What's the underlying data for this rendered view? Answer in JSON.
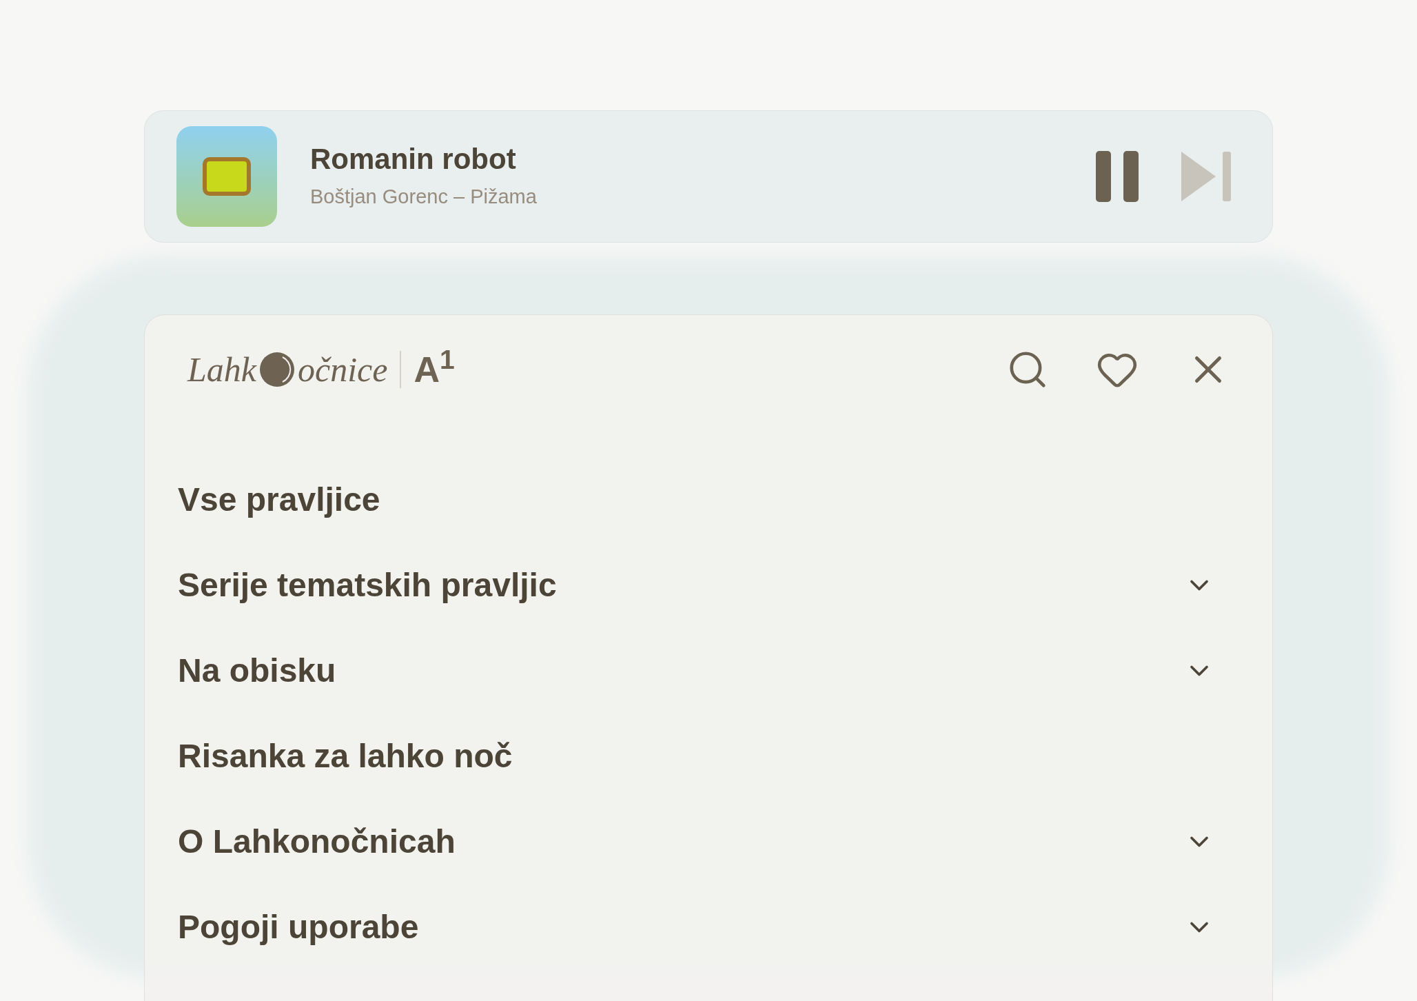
{
  "player": {
    "title": "Romanin robot",
    "subtitle": "Boštjan Gorenc – Pižama",
    "playing": true,
    "next_disabled": true
  },
  "header": {
    "logo_start": "Lahk",
    "logo_end": "očnice",
    "partner": "A$^{1}$"
  },
  "menu": [
    {
      "label": "Vse pravljice",
      "expandable": false
    },
    {
      "label": "Serije tematskih pravljic",
      "expandable": true
    },
    {
      "label": "Na obisku",
      "expandable": true
    },
    {
      "label": "Risanka za lahko noč",
      "expandable": false
    },
    {
      "label": "O Lahkonočnicah",
      "expandable": true
    },
    {
      "label": "Pogoji uporabe",
      "expandable": true
    }
  ]
}
